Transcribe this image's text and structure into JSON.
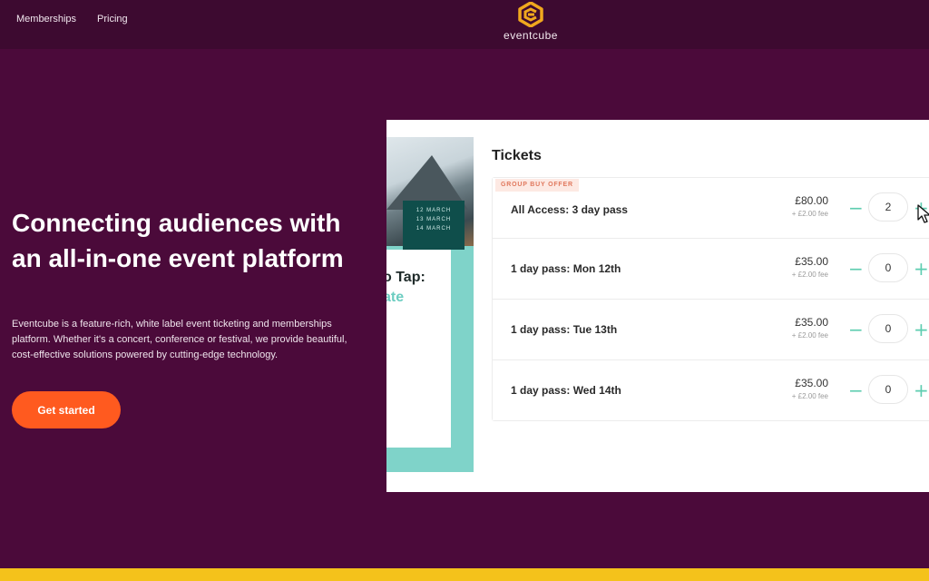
{
  "nav": {
    "links": [
      "Memberships",
      "Pricing"
    ],
    "logo_text": "eventcube"
  },
  "hero": {
    "title": "Connecting audiences with an all-in-one event platform",
    "description": "Eventcube is a feature-rich, white label event ticketing and memberships platform. Whether it's a concert, conference or festival, we provide beautiful, cost-effective solutions powered by cutting-edge technology.",
    "cta_label": "Get started"
  },
  "preview": {
    "poster": {
      "dates": [
        "12 MARCH",
        "13 MARCH",
        "14 MARCH"
      ],
      "text_line1": "o Tap:",
      "text_line2": "ate"
    },
    "tickets_title": "Tickets",
    "offer_badge": "GROUP BUY OFFER",
    "tickets": [
      {
        "name": "All Access: 3 day pass",
        "price": "£80.00",
        "fee": "+ £2.00 fee",
        "quantity": "2"
      },
      {
        "name": "1 day pass: Mon 12th",
        "price": "£35.00",
        "fee": "+ £2.00 fee",
        "quantity": "0"
      },
      {
        "name": "1 day pass: Tue 13th",
        "price": "£35.00",
        "fee": "+ £2.00 fee",
        "quantity": "0"
      },
      {
        "name": "1 day pass: Wed 14th",
        "price": "£35.00",
        "fee": "+ £2.00 fee",
        "quantity": "0"
      }
    ],
    "minus_glyph": "−",
    "plus_glyph": "+"
  },
  "colors": {
    "background": "#4b0a3a",
    "topbar": "#3d0a30",
    "cta": "#ff5a1f",
    "logo": "#f0a81e",
    "stepper": "#5ecdb0",
    "stripe": "#f4c21b"
  }
}
